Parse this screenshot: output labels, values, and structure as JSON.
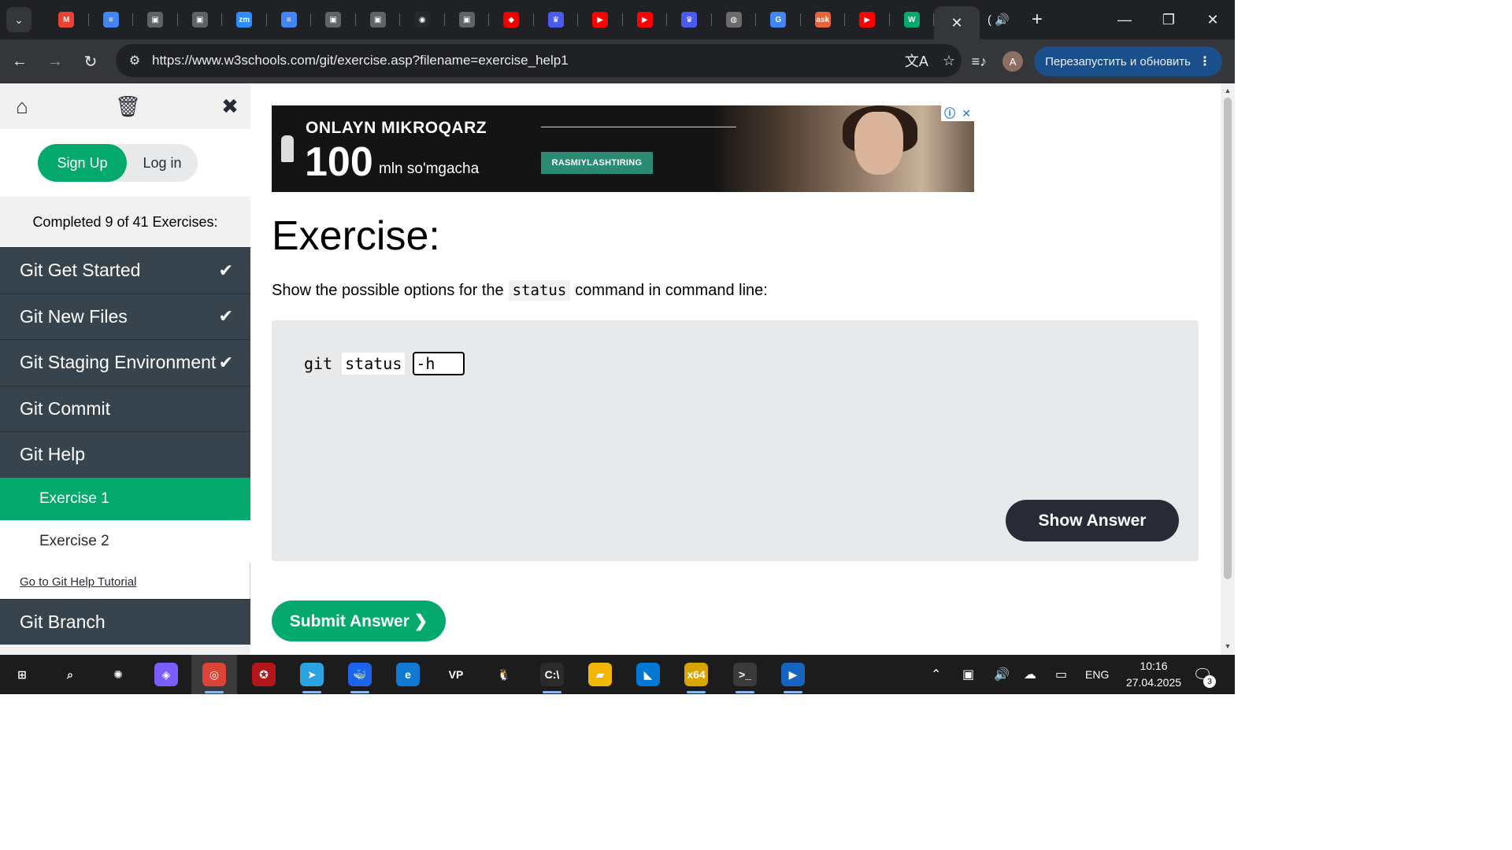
{
  "browser": {
    "tabs": [
      {
        "name": "gmail",
        "glyph": "M",
        "color": "#ea4335"
      },
      {
        "name": "docs",
        "glyph": "≡",
        "color": "#4285f4"
      },
      {
        "name": "classroom",
        "glyph": "▣",
        "color": "#5f6368"
      },
      {
        "name": "classroom",
        "glyph": "▣",
        "color": "#5f6368"
      },
      {
        "name": "zoom",
        "glyph": "zm",
        "color": "#2d8cff"
      },
      {
        "name": "docs",
        "glyph": "≡",
        "color": "#4285f4"
      },
      {
        "name": "classroom",
        "glyph": "▣",
        "color": "#5f6368"
      },
      {
        "name": "classroom",
        "glyph": "▣",
        "color": "#5f6368"
      },
      {
        "name": "github",
        "glyph": "◉",
        "color": "#24292e"
      },
      {
        "name": "classroom",
        "glyph": "▣",
        "color": "#5f6368"
      },
      {
        "name": "redhat",
        "glyph": "◆",
        "color": "#ee0000"
      },
      {
        "name": "crown",
        "glyph": "♛",
        "color": "#4a5cf0"
      },
      {
        "name": "youtube",
        "glyph": "▶",
        "color": "#ff0000"
      },
      {
        "name": "youtube",
        "glyph": "▶",
        "color": "#ff0000"
      },
      {
        "name": "crown",
        "glyph": "♛",
        "color": "#4a5cf0"
      },
      {
        "name": "globe",
        "glyph": "◍",
        "color": "#6b6b6b"
      },
      {
        "name": "translate",
        "glyph": "G",
        "color": "#4285f4"
      },
      {
        "name": "ask",
        "glyph": "ask",
        "color": "#e8633a"
      },
      {
        "name": "youtube",
        "glyph": "▶",
        "color": "#ff0000"
      },
      {
        "name": "w3schools",
        "glyph": "W",
        "color": "#04aa6d"
      }
    ],
    "url": "https://www.w3schools.com/git/exercise.asp?filename=exercise_help1",
    "profile_initial": "A",
    "relaunch_label": "Перезапустить и обновить",
    "audio_tab_label": "("
  },
  "sidebar": {
    "signup_label": "Sign Up",
    "login_label": "Log in",
    "completed_text": "Completed 9 of 41 Exercises:",
    "sections": [
      {
        "label": "Git Get Started",
        "done": true
      },
      {
        "label": "Git New Files",
        "done": true
      },
      {
        "label": "Git Staging Environment",
        "done": true
      },
      {
        "label": "Git Commit",
        "done": false
      },
      {
        "label": "Git Help",
        "done": false
      }
    ],
    "sub_items": [
      {
        "label": "Exercise 1",
        "active": true
      },
      {
        "label": "Exercise 2",
        "active": false
      }
    ],
    "tutorial_link": "Go to Git Help Tutorial",
    "next_section": "Git Branch"
  },
  "ad": {
    "title": "ONLAYN MIKROQARZ",
    "number": "100",
    "unit": "mln so'mgacha",
    "cta": "RASMIYLASHTIRING"
  },
  "exercise": {
    "title": "Exercise:",
    "desc_before": "Show the possible options for the",
    "desc_code": "status",
    "desc_after": "command in command line:",
    "code_tok1": "git",
    "code_tok2": "status",
    "answer_value": "-h",
    "show_answer_label": "Show Answer",
    "submit_label": "Submit Answer ❯"
  },
  "taskbar": {
    "apps": [
      {
        "name": "windows-start",
        "glyph": "⊞",
        "color": "#1c1c1c"
      },
      {
        "name": "search",
        "glyph": "⌕",
        "color": "#1c1c1c"
      },
      {
        "name": "chatgpt",
        "glyph": "✺",
        "color": "#1c1c1c"
      },
      {
        "name": "copilot",
        "glyph": "◈",
        "color": "#7b5cff"
      },
      {
        "name": "chrome",
        "glyph": "◎",
        "color": "#db4437"
      },
      {
        "name": "antivirus",
        "glyph": "✪",
        "color": "#b3161b"
      },
      {
        "name": "telegram",
        "glyph": "➤",
        "color": "#2aa3e0"
      },
      {
        "name": "docker",
        "glyph": "🐳",
        "color": "#1d63ed"
      },
      {
        "name": "edge",
        "glyph": "e",
        "color": "#0f7ad1"
      },
      {
        "name": "visual-paradigm",
        "glyph": "VP",
        "color": "#1c1c1c"
      },
      {
        "name": "penguin",
        "glyph": "🐧",
        "color": "#1c1c1c"
      },
      {
        "name": "cmd",
        "glyph": "C:\\",
        "color": "#2b2b2b"
      },
      {
        "name": "explorer",
        "glyph": "▰",
        "color": "#f2b705"
      },
      {
        "name": "vscode",
        "glyph": "◣",
        "color": "#0078d4"
      },
      {
        "name": "x64dbg",
        "glyph": "x64",
        "color": "#d9a300"
      },
      {
        "name": "powershell-terminal",
        "glyph": ">_",
        "color": "#3a3a3a"
      },
      {
        "name": "media-player",
        "glyph": "▶",
        "color": "#1565c0"
      }
    ],
    "language": "ENG",
    "time": "10:16",
    "date": "27.04.2025",
    "notification_count": "3"
  }
}
